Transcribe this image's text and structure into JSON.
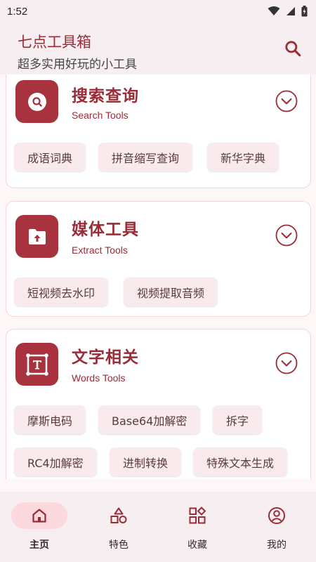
{
  "status": {
    "time": "1:52"
  },
  "header": {
    "title": "七点工具箱",
    "subtitle": "超多实用好玩的小工具"
  },
  "categories": [
    {
      "title": "搜索查询",
      "subtitle": "Search Tools",
      "icon": "search-icon",
      "tools": [
        "成语词典",
        "拼音缩写查询",
        "新华字典"
      ]
    },
    {
      "title": "媒体工具",
      "subtitle": "Extract Tools",
      "icon": "folder-upload-icon",
      "tools": [
        "短视频去水印",
        "视频提取音频"
      ]
    },
    {
      "title": "文字相关",
      "subtitle": "Words Tools",
      "icon": "text-frame-icon",
      "tools": [
        "摩斯电码",
        "Base64加解密",
        "拆字",
        "RC4加解密",
        "进制转换",
        "特殊文本生成"
      ]
    }
  ],
  "nav": {
    "items": [
      {
        "label": "主页",
        "icon": "home-icon",
        "active": true
      },
      {
        "label": "特色",
        "icon": "shapes-icon",
        "active": false
      },
      {
        "label": "收藏",
        "icon": "grid-star-icon",
        "active": false
      },
      {
        "label": "我的",
        "icon": "account-icon",
        "active": false
      }
    ]
  },
  "colors": {
    "accent": "#9b2b36",
    "icon_bg": "#a8323d",
    "chip_bg": "#f8eaed",
    "nav_active": "#fbd9dd"
  }
}
